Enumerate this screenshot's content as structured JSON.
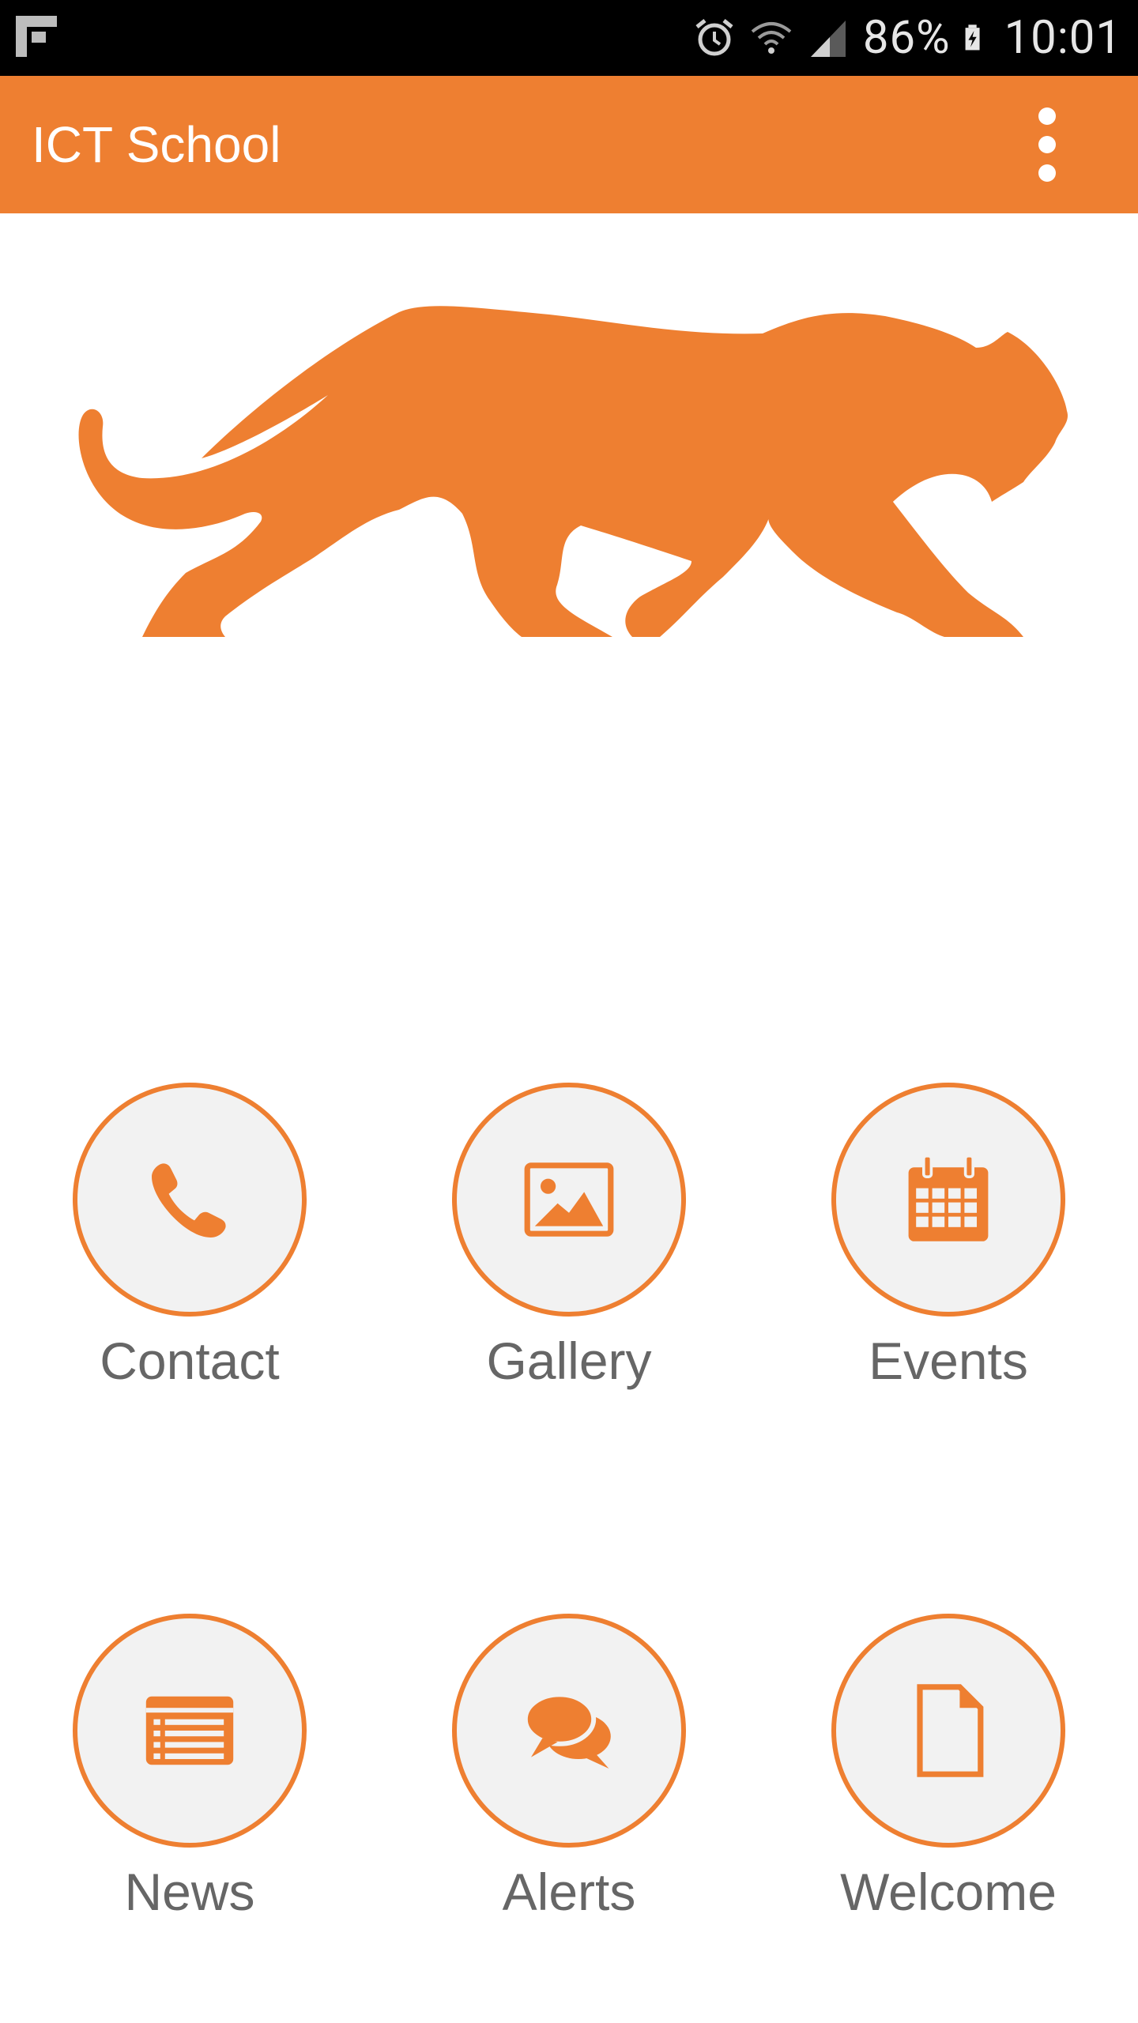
{
  "status_bar": {
    "battery": "86%",
    "time": "10:01"
  },
  "app_bar": {
    "title": "ICT School"
  },
  "colors": {
    "accent": "#ee7f31",
    "tile_bg": "#f2f2f2",
    "label": "#666666"
  },
  "tiles": [
    {
      "label": "Contact",
      "icon": "phone-icon"
    },
    {
      "label": "Gallery",
      "icon": "image-icon"
    },
    {
      "label": "Events",
      "icon": "calendar-icon"
    },
    {
      "label": "News",
      "icon": "newspaper-icon"
    },
    {
      "label": "Alerts",
      "icon": "chat-bubbles-icon"
    },
    {
      "label": "Welcome",
      "icon": "document-icon"
    }
  ]
}
